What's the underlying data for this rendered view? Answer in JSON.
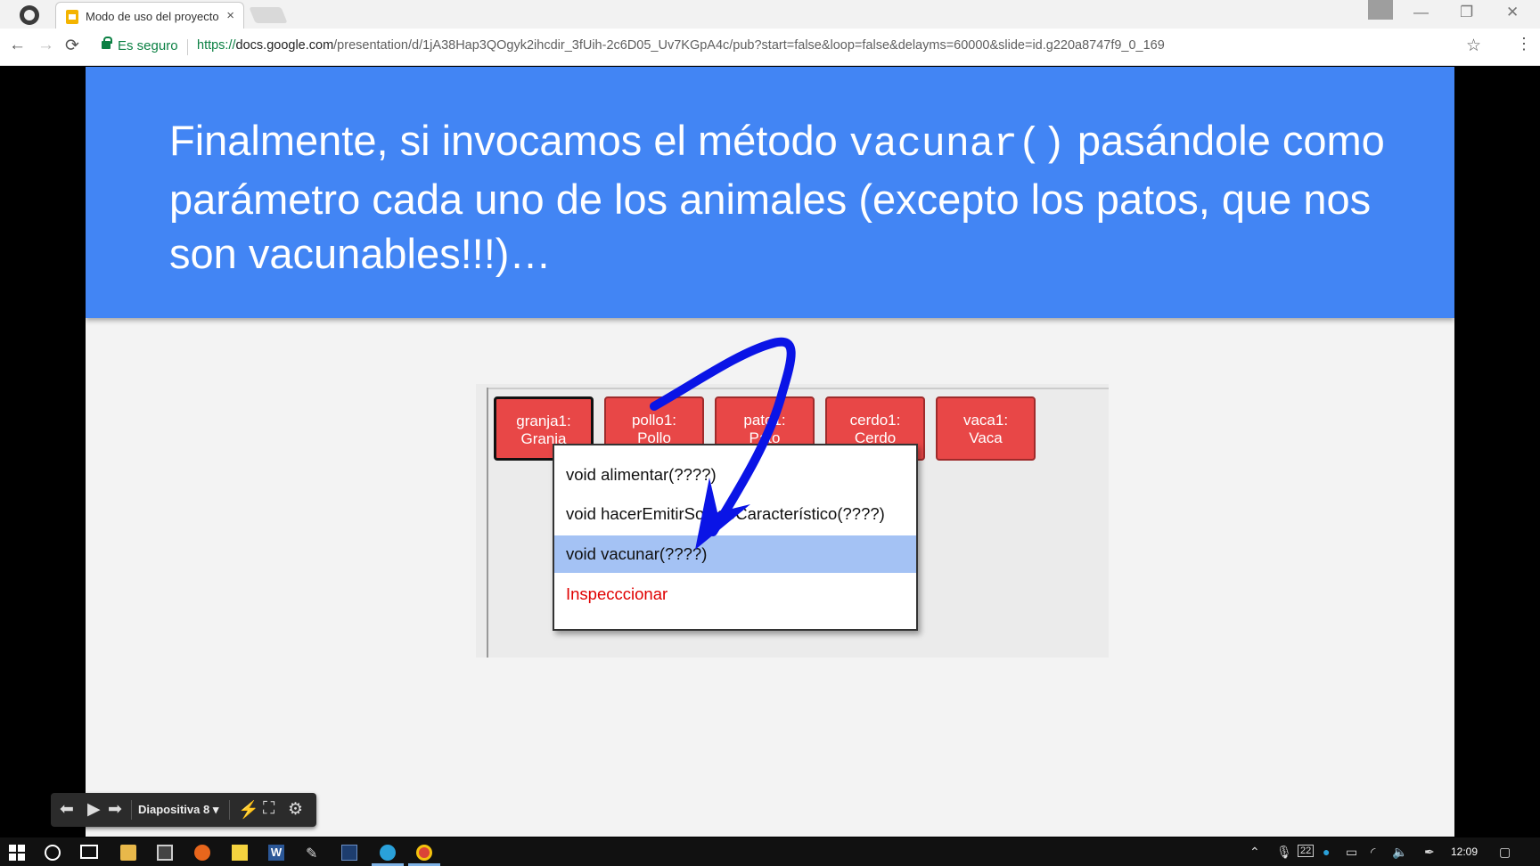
{
  "browser": {
    "tab_title": "Modo de uso del proyecto",
    "tab_close": "×",
    "secure_label": "Es seguro",
    "url_scheme": "https://",
    "url_host": "docs.google.com",
    "url_path": "/presentation/d/1jA38Hap3QOgyk2ihcdir_3fUih-2c6D05_Uv7KGpA4c/pub?start=false&loop=false&delayms=60000&slide=id.g220a8747f9_0_169",
    "back_icon": "←",
    "forward_icon": "→",
    "reload_icon": "⟳",
    "star_icon": "☆",
    "menu_icon": "⋮",
    "minimize_icon": "—",
    "restore_icon": "❐",
    "close_icon": "✕"
  },
  "slide": {
    "title_part1": "Finalmente, si invocamos el método ",
    "title_code": "vacunar()",
    "title_part2": " pasándole como parámetro cada uno de los animales (excepto los patos, que nos son vacunables!!!)…",
    "objects": [
      {
        "line1": "granja1:",
        "line2": "Granja"
      },
      {
        "line1": "pollo1:",
        "line2": "Pollo"
      },
      {
        "line1": "pato1:",
        "line2": "Pato"
      },
      {
        "line1": "cerdo1:",
        "line2": "Cerdo"
      },
      {
        "line1": "vaca1:",
        "line2": "Vaca"
      }
    ],
    "context_menu": [
      "void alimentar(????)",
      "void hacerEmitirSonidoCaracterístico(????)",
      "void vacunar(????)",
      "Inspecccionar"
    ],
    "arrow_color": "#0a14e6"
  },
  "presenter": {
    "slide_label": "Diapositiva 8"
  },
  "taskbar": {
    "clock": "12:09",
    "badge": "22"
  },
  "colors": {
    "slide_header": "#4285f4",
    "object_fill": "#e84747",
    "menu_highlight": "#a4c2f4",
    "inspect_text": "#e00000"
  }
}
